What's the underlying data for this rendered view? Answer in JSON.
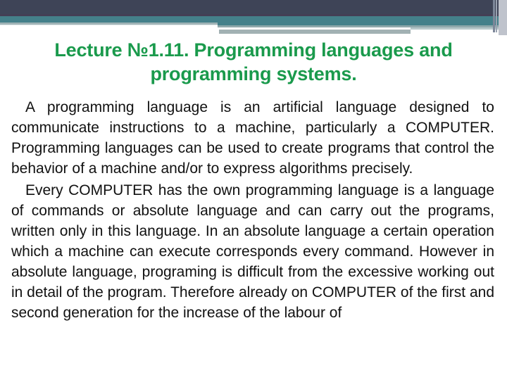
{
  "slide": {
    "title_line1": "Lecture №1.11. Programming languages and",
    "title_line2": "programming systems.",
    "paragraphs": [
      "A programming language is an artificial language designed to communicate instructions to a machine, particularly a COMPUTER. Programming languages can be used to create programs that control the behavior of a machine and/or to express algorithms precisely.",
      "Every COMPUTER has the own programming language is a language of commands or absolute language and can carry out the programs, written only in this language. In an absolute language a certain operation which a machine can execute corresponds every command. However in absolute language, programing is difficult from the excessive working out in detail of the program. Therefore already on COMPUTER of the first and second generation for the increase of the labour of"
    ]
  },
  "colors": {
    "title": "#1a9a4c",
    "body_text": "#111111",
    "header_dark": "#3e4457",
    "header_teal": "#44808a"
  }
}
